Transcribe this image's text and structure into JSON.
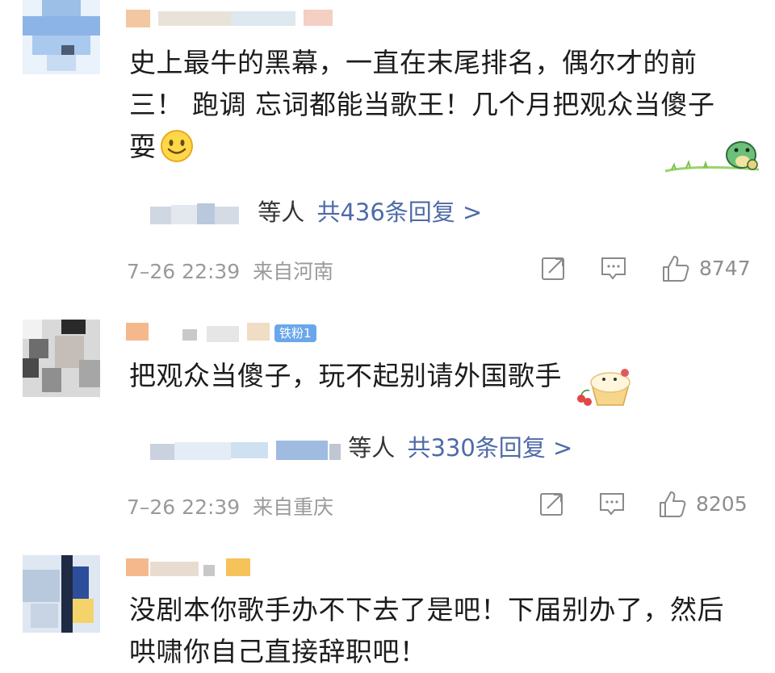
{
  "comments": [
    {
      "text": "史上最牛的黑幕，一直在末尾排名，偶尔才的前三！ 跑调 忘词都能当歌王！几个月把观众当傻子耍",
      "line1": "史上最牛的黑幕，一直在末尾排名，偶尔才的前",
      "line2": "三！ 跑调 忘词都能当歌王！几个月把观众当傻子",
      "line3": "耍",
      "replies_suffix": "等人",
      "replies_count": "共436条回复 >",
      "time": "7–26 22:39",
      "location": "来自河南",
      "likes": "8747"
    },
    {
      "text": "把观众当傻子，玩不起别请外国歌手",
      "badge": "铁粉1",
      "replies_suffix": "等人",
      "replies_count": "共330条回复 >",
      "time": "7–26 22:39",
      "location": "来自重庆",
      "likes": "8205"
    },
    {
      "line1": "没剧本你歌手办不下去了是吧！下届别办了，然后",
      "line2": "哄啸你自己直接辞职吧！"
    }
  ],
  "icons": {
    "share": "share-icon",
    "comment": "comment-icon",
    "like": "thumbs-up-icon"
  },
  "colors": {
    "link": "#4e6aa8",
    "meta": "#9a9a9a",
    "badge": "#6aa7ea"
  }
}
